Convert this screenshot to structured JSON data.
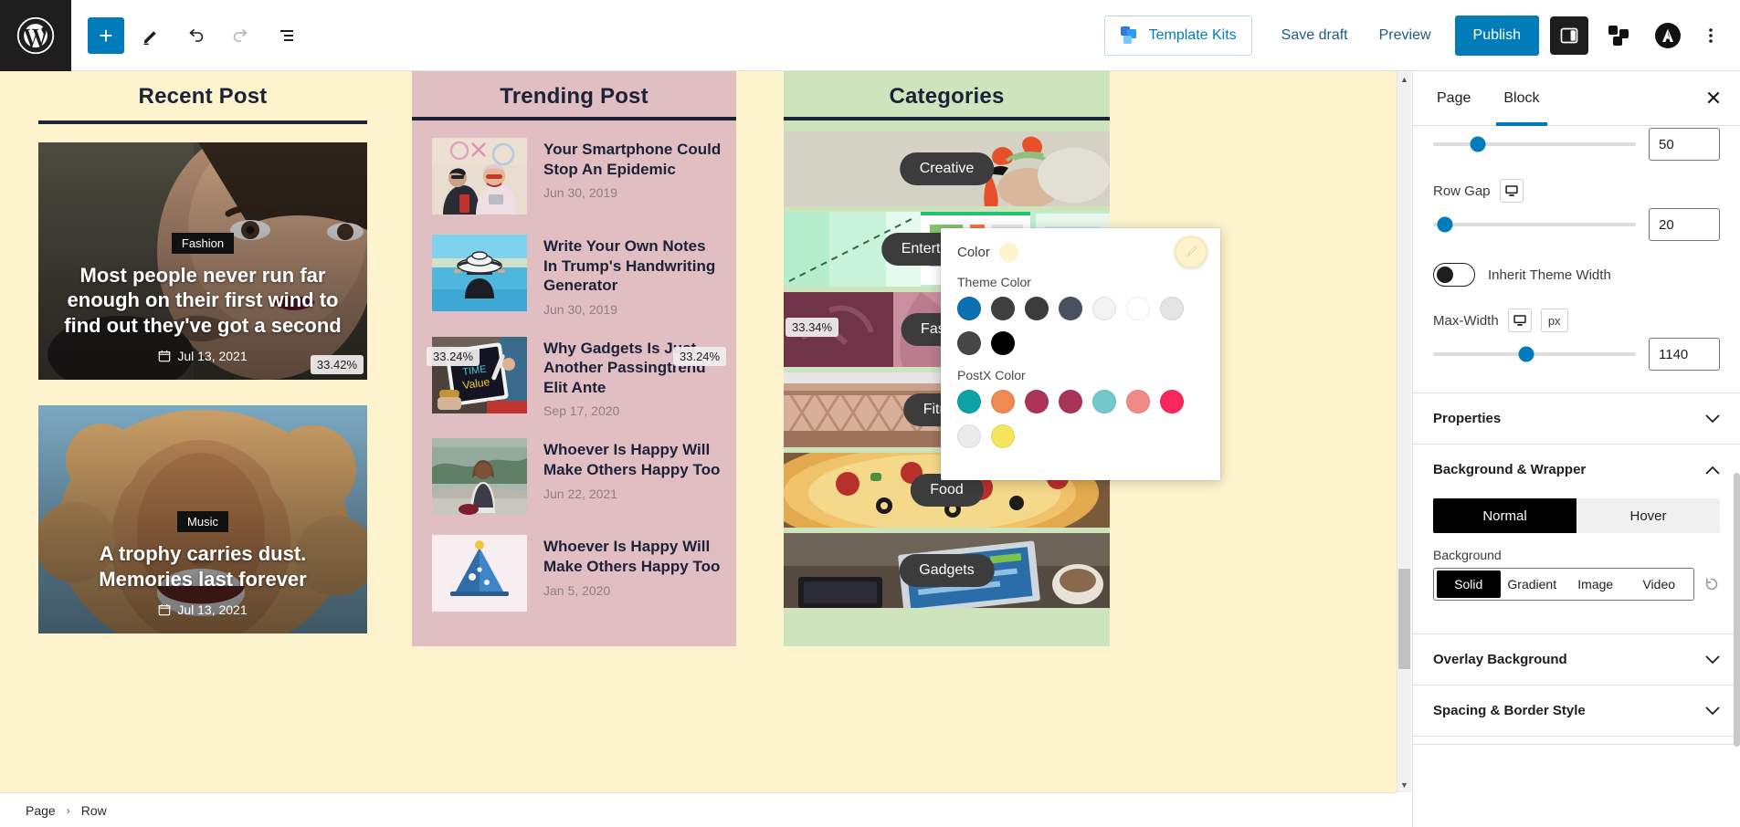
{
  "topbar": {
    "logo_icon": "wordpress-logo-icon",
    "add_block_label": "+",
    "tools": [
      {
        "name": "tools-pencil-icon",
        "title": "Tools"
      },
      {
        "name": "undo-icon",
        "title": "Undo"
      },
      {
        "name": "redo-icon",
        "title": "Redo"
      },
      {
        "name": "list-view-icon",
        "title": "Document Overview"
      }
    ],
    "template_kits_label": "Template Kits",
    "save_draft_label": "Save draft",
    "preview_label": "Preview",
    "publish_label": "Publish",
    "settings_icon": "sidebar-panel-icon",
    "blocks_icon": "blocks-icon",
    "avatar_icon": "astra-avatar-icon",
    "kebab_icon": "more-options-icon"
  },
  "canvas": {
    "background_color": "#fdf3cd",
    "recent": {
      "title": "Recent Post",
      "posts": [
        {
          "category": "Fashion",
          "title": "Most people never run far enough on their first wind to find out they've got a second",
          "date": "Jul 13, 2021",
          "date_icon": "calendar-icon"
        },
        {
          "category": "Music",
          "title": "A trophy carries dust. Memories last forever",
          "date": "Jul 13, 2021",
          "date_icon": "calendar-icon"
        }
      ],
      "width_badge": "33.42%"
    },
    "trending": {
      "title": "Trending Post",
      "background_color": "#e0bec1",
      "posts": [
        {
          "title": "Your Smartphone Could Stop An Epidemic",
          "date": "Jun 30, 2019"
        },
        {
          "title": "Write Your Own Notes In Trump's Handwriting Generator",
          "date": "Jun 30, 2019"
        },
        {
          "title": "Why Gadgets Is Just Another Passingtrend Elit Ante",
          "date": "Sep 17, 2020"
        },
        {
          "title": "Whoever Is Happy Will Make Others Happy Too",
          "date": "Jun 22, 2021"
        },
        {
          "title": "Whoever Is Happy Will Make Others Happy Too",
          "date": "Jan 5, 2020"
        }
      ],
      "width_badge_left": "33.24%",
      "width_badge_right": "33.24%"
    },
    "categories": {
      "title": "Categories",
      "background_color": "#cde4bd",
      "items": [
        {
          "label": "Creative"
        },
        {
          "label": "Entertainment"
        },
        {
          "label": "Fashion"
        },
        {
          "label": "Fitness"
        },
        {
          "label": "Food"
        },
        {
          "label": "Gadgets"
        }
      ],
      "width_badge": "33.34%"
    }
  },
  "sidebar": {
    "tabs": [
      {
        "label": "Page",
        "active": false
      },
      {
        "label": "Block",
        "active": true
      }
    ],
    "close_icon": "close-icon",
    "controls": {
      "top_slider_value": "50",
      "row_gap_label": "Row Gap",
      "row_gap_value": "20",
      "row_gap_device_icon": "desktop-icon",
      "inherit_theme_width_label": "Inherit Theme Width",
      "inherit_theme_width_on": false,
      "max_width_label": "Max-Width",
      "max_width_device_icon": "desktop-icon",
      "max_width_unit": "px",
      "max_width_value": "1140"
    },
    "panels": [
      {
        "label": "Properties",
        "expanded": false,
        "chevron": "chevron-down-icon"
      },
      {
        "label": "Background & Wrapper",
        "expanded": true,
        "chevron": "chevron-up-icon"
      },
      {
        "label": "Overlay Background",
        "expanded": false,
        "chevron": "chevron-down-icon"
      },
      {
        "label": "Spacing & Border Style",
        "expanded": false,
        "chevron": "chevron-down-icon"
      }
    ],
    "state_tabs": [
      {
        "label": "Normal",
        "active": true
      },
      {
        "label": "Hover",
        "active": false
      }
    ],
    "background_label": "Background",
    "background_types": [
      {
        "label": "Solid",
        "active": true
      },
      {
        "label": "Gradient",
        "active": false
      },
      {
        "label": "Image",
        "active": false
      },
      {
        "label": "Video",
        "active": false
      }
    ],
    "reset_icon": "reset-icon"
  },
  "color_popover": {
    "color_label": "Color",
    "current_color": "#fdf3cd",
    "brush_icon": "color-picker-brush-icon",
    "theme_group_label": "Theme Color",
    "theme_colors": [
      "#0b6fb1",
      "#3f3f3f",
      "#3c3c3c",
      "#4a5261",
      "#f3f3f3",
      "#ffffff",
      "#e4e4e4",
      "#464646",
      "#000000"
    ],
    "postx_group_label": "PostX Color",
    "postx_colors": [
      "#0ba3a6",
      "#ed8b52",
      "#ac3557",
      "#a73558",
      "#72c8cb",
      "#ef8a84",
      "#f9275c",
      "#ebebeb",
      "#f5e55d"
    ]
  },
  "bottombar": {
    "items": [
      {
        "label": "Page"
      },
      {
        "label": "Row"
      }
    ],
    "separator": "›"
  }
}
